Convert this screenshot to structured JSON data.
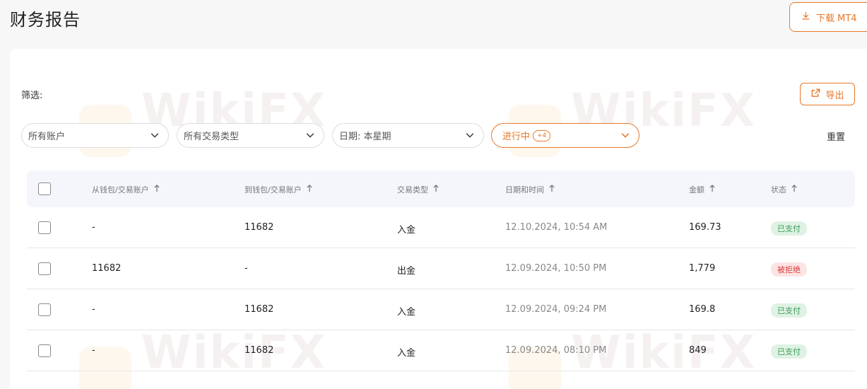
{
  "header": {
    "title": "财务报告",
    "download_label": "下载 MT4"
  },
  "filters": {
    "label": "筛选:",
    "export_label": "导出",
    "account_placeholder": "所有账户",
    "type_placeholder": "所有交易类型",
    "date_value": "日期: 本星期",
    "status_value": "进行中",
    "status_extra": "+4",
    "reset_label": "重置"
  },
  "table": {
    "columns": [
      "从钱包/交易账户",
      "到钱包/交易账户",
      "交易类型",
      "日期和时间",
      "金额",
      "状态"
    ],
    "rows": [
      {
        "from": "-",
        "to": "11682",
        "type": "入金",
        "datetime": "12.10.2024, 10:54 AM",
        "amount": "169.73",
        "status": "已支付"
      },
      {
        "from": "11682",
        "to": "-",
        "type": "出金",
        "datetime": "12.09.2024, 10:50 PM",
        "amount": "1,779",
        "status": "被拒绝"
      },
      {
        "from": "-",
        "to": "11682",
        "type": "入金",
        "datetime": "12.09.2024, 09:24 PM",
        "amount": "169.8",
        "status": "已支付"
      },
      {
        "from": "-",
        "to": "11682",
        "type": "入金",
        "datetime": "12.09.2024, 08:10 PM",
        "amount": "849",
        "status": "已支付"
      }
    ]
  },
  "watermark": "WikiFX",
  "colors": {
    "accent": "#e8782a",
    "paid": "#3a9b57",
    "rejected": "#d44040"
  }
}
